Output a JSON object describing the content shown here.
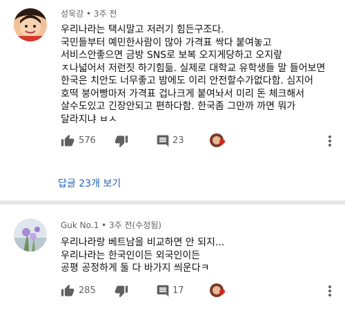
{
  "comments": [
    {
      "author": "성욱강",
      "time": "3주 전",
      "lines": [
        "우리나라는 택시말고 저러기 힘든구조다.",
        "국민들부터 예민한사람이 많아 가격표 싹다 붙여놓고",
        "서비스안좋으면 금방 SNS로 보복 오지게당하고 오지랖",
        "ㅈ나넓어서 저런짓 하기힘듦. 실제로 대학교 유학생들 말 들어보면",
        "한국은 치안도 너무좋고 밤에도 이리 안전할수가없다함. 심지어",
        "호떡 붕어빵마저 가격표 겁나크게 붙여놔서 미리 돈 체크해서",
        "살수도있고 긴장안되고 편하다함. 한국좀 그만까 까면 뭐가",
        "달라지냐 ㅂㅅ"
      ],
      "likes": "576",
      "replies": "23",
      "view_replies": "답글 23개 보기"
    },
    {
      "author": "Guk No.1",
      "time": "3주 전(수정됨)",
      "lines": [
        "우리나라랑 베트남을 비교하면 안 되지...",
        "우리나라는 한국인이든 외국인이든",
        "공평 공정하게 둘 다 바가지 씌운다ㅋ"
      ],
      "likes": "285",
      "replies": "17"
    }
  ],
  "meta_separator": " • ",
  "colors": {
    "link": "#1c62b9",
    "heart": "#e62117",
    "meta": "#606060"
  },
  "icons": [
    "thumbs-up-icon",
    "thumbs-down-icon",
    "reply-icon",
    "creator-heart-icon",
    "more-vert-icon"
  ]
}
